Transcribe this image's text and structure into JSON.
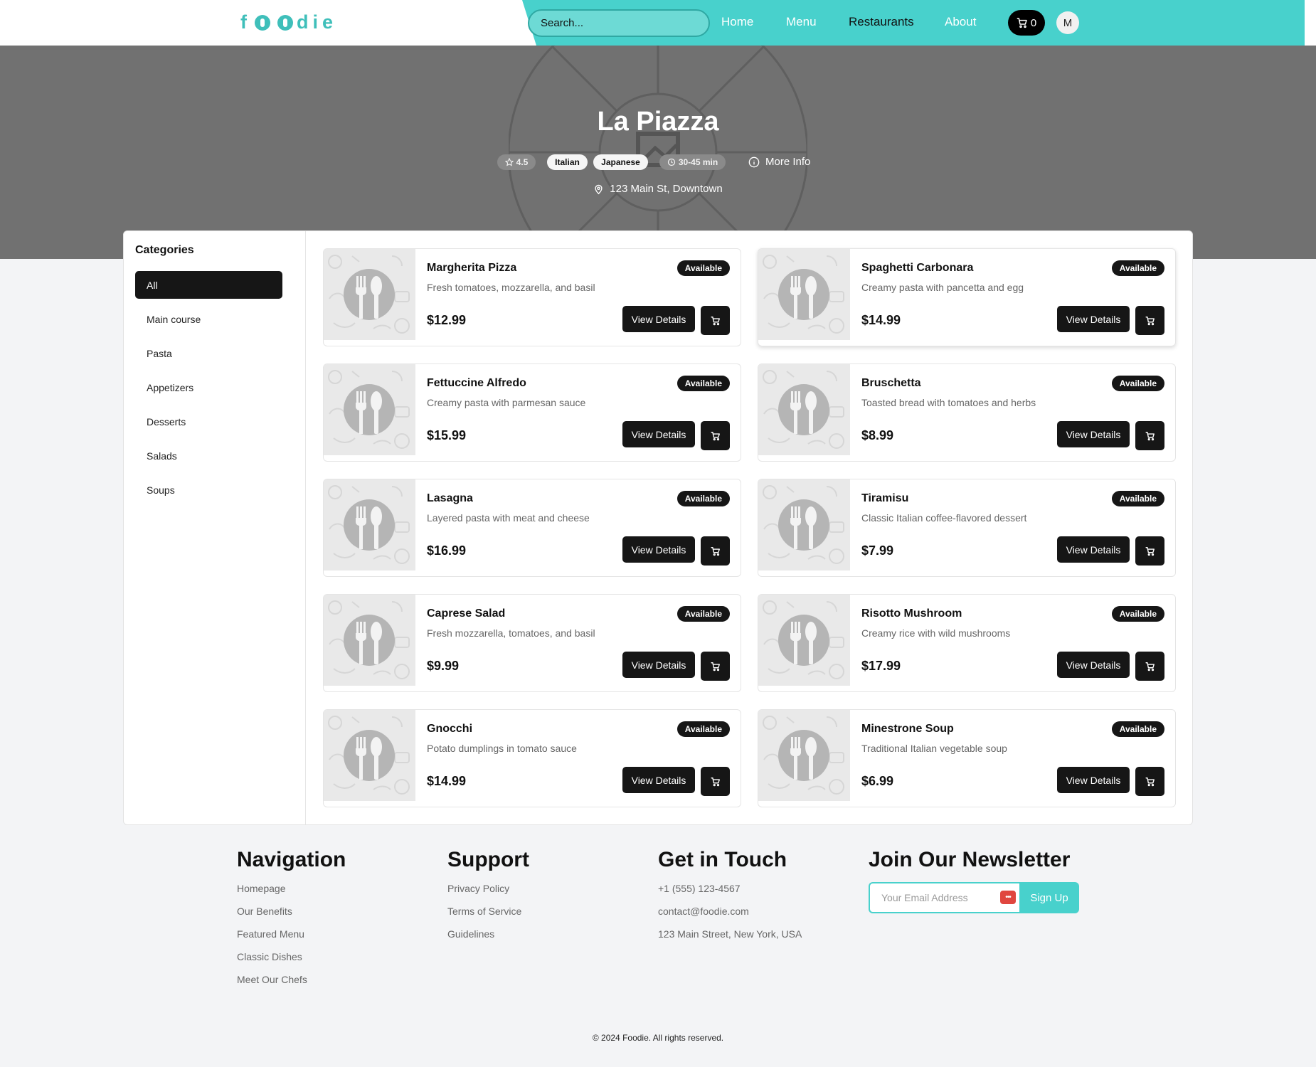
{
  "brand": {
    "logo_text": "foodie",
    "accent_color": "#48d1cc"
  },
  "header": {
    "search_placeholder": "Search...",
    "nav": [
      "Home",
      "Menu",
      "Restaurants",
      "About"
    ],
    "active_nav": "Restaurants",
    "cart_count": "0",
    "avatar_initial": "M"
  },
  "restaurant": {
    "name": "La Piazza",
    "rating": "4.5",
    "cuisines": [
      "Italian",
      "Japanese"
    ],
    "delivery_time": "30-45 min",
    "more_info_label": "More Info",
    "address": "123 Main St, Downtown"
  },
  "sidebar": {
    "title": "Categories",
    "categories": [
      "All",
      "Main course",
      "Pasta",
      "Appetizers",
      "Desserts",
      "Salads",
      "Soups"
    ],
    "active": "All"
  },
  "menu": {
    "view_details_label": "View Details",
    "items": [
      {
        "name": "Margherita Pizza",
        "description": "Fresh tomatoes, mozzarella, and basil",
        "price": "$12.99",
        "status": "Available"
      },
      {
        "name": "Spaghetti Carbonara",
        "description": "Creamy pasta with pancetta and egg",
        "price": "$14.99",
        "status": "Available"
      },
      {
        "name": "Fettuccine Alfredo",
        "description": "Creamy pasta with parmesan sauce",
        "price": "$15.99",
        "status": "Available"
      },
      {
        "name": "Bruschetta",
        "description": "Toasted bread with tomatoes and herbs",
        "price": "$8.99",
        "status": "Available"
      },
      {
        "name": "Lasagna",
        "description": "Layered pasta with meat and cheese",
        "price": "$16.99",
        "status": "Available"
      },
      {
        "name": "Tiramisu",
        "description": "Classic Italian coffee-flavored dessert",
        "price": "$7.99",
        "status": "Available"
      },
      {
        "name": "Caprese Salad",
        "description": "Fresh mozzarella, tomatoes, and basil",
        "price": "$9.99",
        "status": "Available"
      },
      {
        "name": "Risotto Mushroom",
        "description": "Creamy rice with wild mushrooms",
        "price": "$17.99",
        "status": "Available"
      },
      {
        "name": "Gnocchi",
        "description": "Potato dumplings in tomato sauce",
        "price": "$14.99",
        "status": "Available"
      },
      {
        "name": "Minestrone Soup",
        "description": "Traditional Italian vegetable soup",
        "price": "$6.99",
        "status": "Available"
      }
    ]
  },
  "footer": {
    "navigation": {
      "title": "Navigation",
      "links": [
        "Homepage",
        "Our Benefits",
        "Featured Menu",
        "Classic Dishes",
        "Meet Our Chefs"
      ]
    },
    "support": {
      "title": "Support",
      "links": [
        "Privacy Policy",
        "Terms of Service",
        "Guidelines"
      ]
    },
    "contact": {
      "title": "Get in Touch",
      "lines": [
        "+1 (555) 123-4567",
        "contact@foodie.com",
        "123 Main Street, New York, USA"
      ]
    },
    "newsletter": {
      "title": "Join Our Newsletter",
      "placeholder": "Your Email Address",
      "button": "Sign Up"
    },
    "copyright": "© 2024 Foodie. All rights reserved."
  }
}
